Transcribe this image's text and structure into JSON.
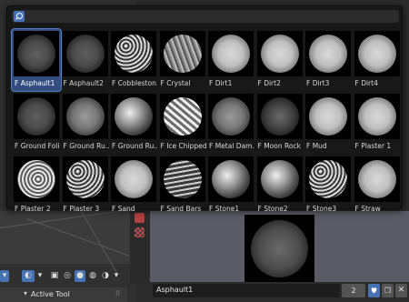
{
  "search": {
    "value": "",
    "placeholder": ""
  },
  "brushes": [
    {
      "label": "F Asphault1",
      "selected": true,
      "style": "soft"
    },
    {
      "label": "F Asphault2",
      "style": "soft"
    },
    {
      "label": "F Cobbleston...",
      "style": "cobble"
    },
    {
      "label": "F Crystal",
      "style": "crystal"
    },
    {
      "label": "F Dirt1",
      "style": "bright"
    },
    {
      "label": "F Dirt2",
      "style": "bright"
    },
    {
      "label": "F Dirt3",
      "style": "bright"
    },
    {
      "label": "F Dirt4",
      "style": "bright"
    },
    {
      "label": "F Ground Foli...",
      "style": "soft"
    },
    {
      "label": "F Ground Ru...",
      "style": "mid"
    },
    {
      "label": "F Ground Ru...",
      "style": "rough"
    },
    {
      "label": "F Ice Chipped",
      "style": "ice"
    },
    {
      "label": "F Metal Dam...",
      "style": "mid"
    },
    {
      "label": "F Moon Rock",
      "style": "dark"
    },
    {
      "label": "F Mud",
      "style": "bright"
    },
    {
      "label": "F Plaster 1",
      "style": "bright"
    },
    {
      "label": "F Plaster 2",
      "style": "swirl"
    },
    {
      "label": "F Plaster 3",
      "style": "cobble"
    },
    {
      "label": "F Sand",
      "style": "bright"
    },
    {
      "label": "F Sand Bars",
      "style": "bars"
    },
    {
      "label": "F Stone1",
      "style": "rough"
    },
    {
      "label": "F Stone2",
      "style": "rough"
    },
    {
      "label": "F Stone3",
      "style": "cobble"
    },
    {
      "label": "F Straw",
      "style": "bright"
    }
  ],
  "datablock": {
    "name": "Asphault1",
    "users": "2"
  },
  "panel": {
    "title": "Active Tool"
  },
  "icons": {
    "search": "search-icon",
    "shield": "fake-user-shield-icon",
    "duplicate": "duplicate-icon",
    "close": "close-icon",
    "checker": "checker-texture-icon",
    "chevron": "chevron-down-icon"
  },
  "colors": {
    "accent": "#4772b3",
    "selection": "#334d80",
    "popup_bg": "#181818",
    "preview_bg": "#5a5b65"
  }
}
